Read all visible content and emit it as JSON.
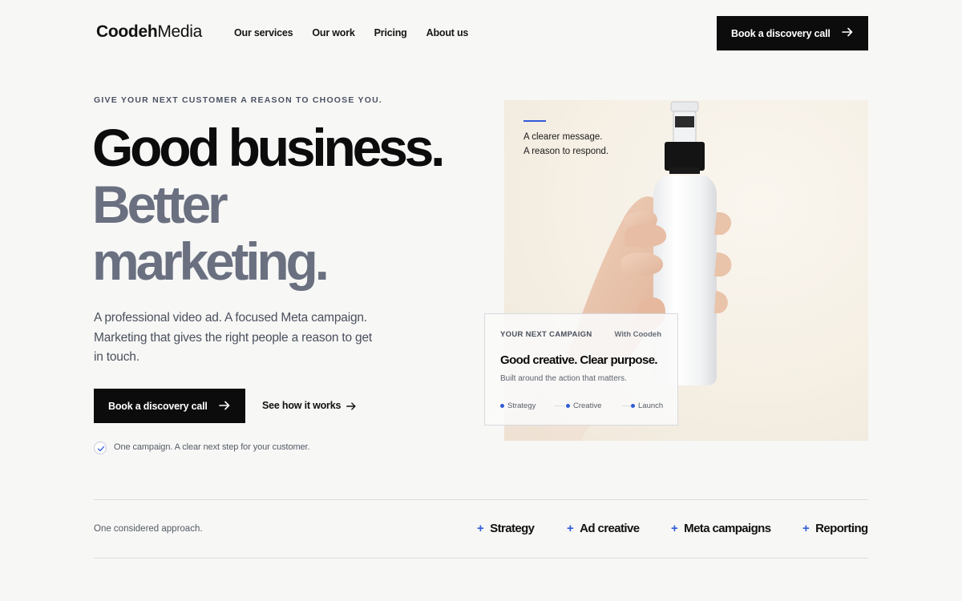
{
  "header": {
    "logo_bold": "Coodeh",
    "logo_light": "Media",
    "nav": [
      "Our services",
      "Our work",
      "Pricing",
      "About us"
    ],
    "cta_label": "Book a discovery call"
  },
  "hero": {
    "eyebrow": "GIVE YOUR NEXT CUSTOMER A REASON TO CHOOSE YOU.",
    "headline_1": "Good business.",
    "headline_2": "Better",
    "headline_3": "marketing.",
    "lede": "A professional video ad. A focused Meta campaign. Marketing that gives the right people a reason to get in touch.",
    "primary_label": "Book a discovery call",
    "secondary_label": "See how it works",
    "check_text": "One campaign. A clear next step for your customer."
  },
  "image": {
    "caption_1": "A clearer message.",
    "caption_2": "A reason to respond."
  },
  "card": {
    "kicker": "YOUR NEXT CAMPAIGN",
    "with": "With Coodeh",
    "title": "Good creative. Clear purpose.",
    "subtitle": "Built around the action that matters.",
    "steps": [
      "Strategy",
      "Creative",
      "Launch"
    ]
  },
  "strip": {
    "approach": "One considered approach.",
    "features": [
      "Strategy",
      "Ad creative",
      "Meta campaigns",
      "Reporting"
    ]
  },
  "colors": {
    "accent": "#2f5bd8",
    "ink": "#0c0c0c",
    "muted_headline": "#6a7080",
    "background": "#f7f7f6"
  }
}
